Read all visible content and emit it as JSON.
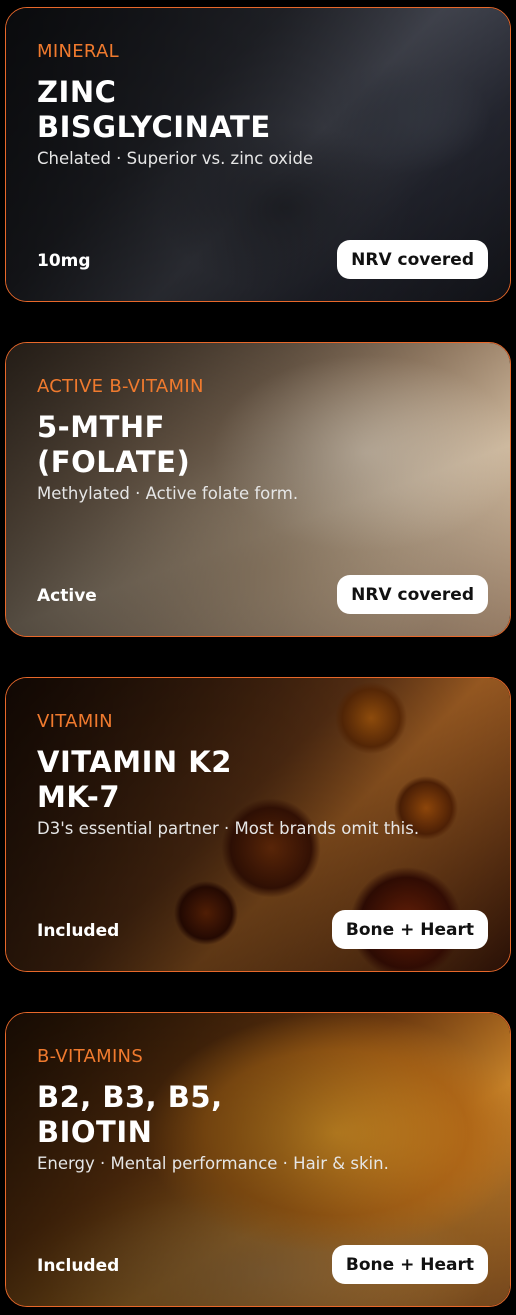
{
  "cards": [
    {
      "category": "MINERAL",
      "title_line1": "ZINC",
      "title_line2": "BISGLYCINATE",
      "subtitle": "Chelated · Superior vs. zinc oxide",
      "footer": "10mg",
      "badge": "NRV covered"
    },
    {
      "category": "ACTIVE B-VITAMIN",
      "title_line1": "5-MTHF",
      "title_line2": "(FOLATE)",
      "subtitle": "Methylated · Active folate form.",
      "footer": "Active",
      "badge": "NRV covered"
    },
    {
      "category": "VITAMIN",
      "title_line1": "VITAMIN K2",
      "title_line2": "MK-7",
      "subtitle": "D3's essential partner · Most brands omit this.",
      "footer": "Included",
      "badge": "Bone + Heart"
    },
    {
      "category": "B-VITAMINS",
      "title_line1": "B2, B3, B5,",
      "title_line2": "BIOTIN",
      "subtitle": "Energy · Mental performance · Hair & skin.",
      "footer": "Included",
      "badge": "Bone + Heart"
    }
  ]
}
